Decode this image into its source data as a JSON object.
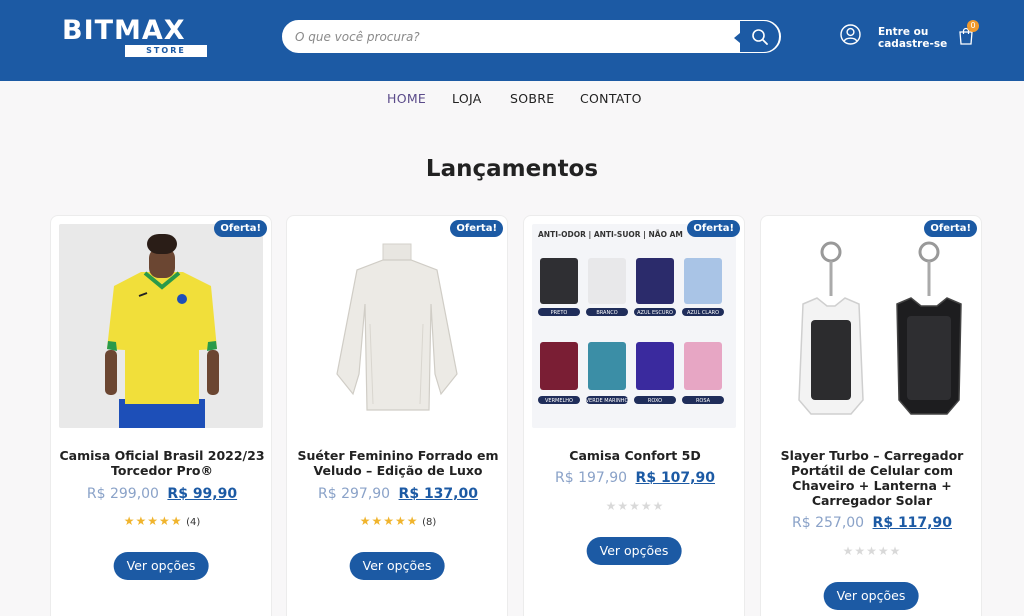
{
  "colors": {
    "brand": "#1c5aa4",
    "badge": "#f19a2d",
    "star": "#f0b42d"
  },
  "header": {
    "logo": "BITMAX",
    "logo_sub": "STORE",
    "search_placeholder": "O que você procura?",
    "login_line1": "Entre ou",
    "login_line2": "cadastre-se",
    "cart_count": "0"
  },
  "nav": {
    "items": [
      "HOME",
      "LOJA",
      "SOBRE",
      "CONTATO"
    ]
  },
  "section": {
    "title": "Lançamentos"
  },
  "products": [
    {
      "badge": "Oferta!",
      "name": "Camisa Oficial Brasil 2022/23 Torcedor Pro®",
      "old_price": "R$ 299,00",
      "new_price": "R$ 99,90",
      "rating": "★★★★★",
      "reviews": "(4)",
      "button": "Ver opções"
    },
    {
      "badge": "Oferta!",
      "name": "Suéter Feminino Forrado em Veludo – Edição de Luxo",
      "old_price": "R$ 297,90",
      "new_price": "R$ 137,00",
      "rating": "★★★★★",
      "reviews": "(8)",
      "button": "Ver opções"
    },
    {
      "badge": "Oferta!",
      "name": "Camisa Confort 5D",
      "old_price": "R$ 197,90",
      "new_price": "R$ 107,90",
      "rating": "★★★★★",
      "reviews": "",
      "button": "Ver opções",
      "image_text": {
        "banner": "ANTI-ODOR | ANTI-SUOR | NÃO AM",
        "colors": [
          "PRETO",
          "BRANCO",
          "AZUL ESCURO",
          "AZUL CLARO",
          "VERMELHO",
          "VERDE MARINHO",
          "ROXO",
          "ROSA"
        ]
      }
    },
    {
      "badge": "Oferta!",
      "name": "Slayer Turbo – Carregador Portátil de Celular com Chaveiro + Lanterna + Carregador Solar",
      "old_price": "R$ 257,00",
      "new_price": "R$ 117,90",
      "rating": "★★★★★",
      "reviews": "",
      "button": "Ver opções"
    }
  ]
}
